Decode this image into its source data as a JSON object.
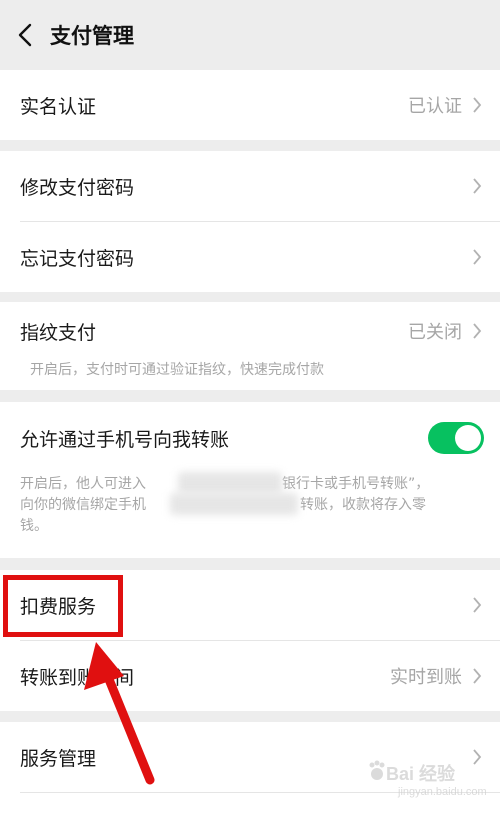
{
  "header": {
    "title": "支付管理"
  },
  "realname": {
    "label": "实名认证",
    "value": "已认证"
  },
  "password": {
    "change_label": "修改支付密码",
    "forgot_label": "忘记支付密码"
  },
  "fingerprint": {
    "label": "指纹支付",
    "value": "已关闭",
    "description": "开启后，支付时可通过验证指纹，快速完成付款"
  },
  "phone_transfer": {
    "label": "允许通过手机号向我转账",
    "toggle_on": true,
    "description_line1": "开启后，他人可进入",
    "description_line1_end": "银行卡或手机号转账”，",
    "description_line2": "向你的微信绑定手机",
    "description_line2_end": "转账，收款将存入零",
    "description_line3": "钱。"
  },
  "fee_service": {
    "label": "扣费服务"
  },
  "transfer_time": {
    "label": "转账到账时间",
    "value": "实时到账"
  },
  "service_mgmt": {
    "label": "服务管理"
  },
  "watermark": {
    "text": "Bai 经验",
    "sub": "jingyan.baidu.com"
  },
  "colors": {
    "toggle": "#07c160",
    "highlight": "#e01010",
    "background": "#ededed"
  }
}
